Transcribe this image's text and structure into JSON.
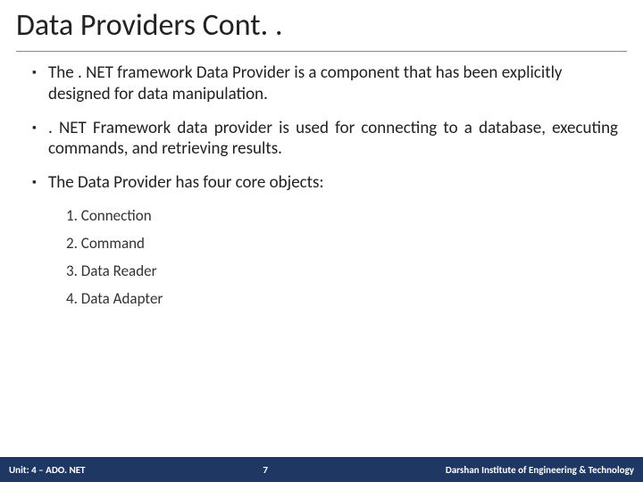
{
  "title": "Data Providers Cont. .",
  "bullets": [
    {
      "text": "The . NET framework Data Provider is a component that has been explicitly designed for data manipulation.",
      "justify": false
    },
    {
      "text": ". NET Framework data provider is used for connecting to a database, executing commands, and retrieving results.",
      "justify": true
    },
    {
      "text": "The Data Provider has four core objects:",
      "justify": false
    }
  ],
  "numbered": [
    "1. Connection",
    "2. Command",
    "3. Data Reader",
    "4. Data Adapter"
  ],
  "footer": {
    "unit": "Unit: 4 – ADO. NET",
    "page": "7",
    "org": "Darshan Institute of Engineering & Technology"
  }
}
